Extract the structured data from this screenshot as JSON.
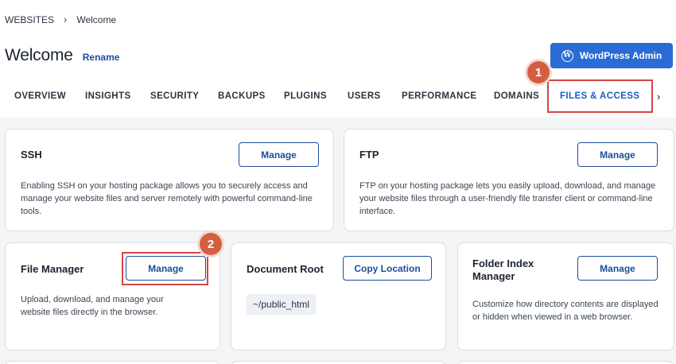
{
  "breadcrumb": {
    "root": "WEBSITES",
    "separator": ">",
    "current": "Welcome"
  },
  "header": {
    "title": "Welcome",
    "rename_label": "Rename",
    "wp_admin_label": "WordPress Admin",
    "wp_icon": "wordpress-icon"
  },
  "tabs": [
    {
      "label": "OVERVIEW"
    },
    {
      "label": "INSIGHTS"
    },
    {
      "label": "SECURITY"
    },
    {
      "label": "BACKUPS"
    },
    {
      "label": "PLUGINS"
    },
    {
      "label": "USERS"
    },
    {
      "label": "PERFORMANCE"
    },
    {
      "label": "DOMAINS"
    },
    {
      "label": "FILES & ACCESS",
      "active": true
    }
  ],
  "tabs_next_icon": "chevron-right-icon",
  "badges": {
    "one": "1",
    "two": "2"
  },
  "cards": {
    "ssh": {
      "title": "SSH",
      "button": "Manage",
      "description": "Enabling SSH on your hosting package allows you to securely access and manage your website files and server remotely with powerful command-line tools."
    },
    "ftp": {
      "title": "FTP",
      "button": "Manage",
      "description": "FTP on your hosting package lets you easily upload, download, and manage your website files through a user-friendly file transfer client or command-line interface."
    },
    "file_manager": {
      "title": "File Manager",
      "button": "Manage",
      "description": "Upload, download, and manage your website files directly in the browser."
    },
    "document_root": {
      "title": "Document Root",
      "button": "Copy Location",
      "path": "~/public_html"
    },
    "folder_index": {
      "title": "Folder Index Manager",
      "button": "Manage",
      "description": "Customize how directory contents are displayed or hidden when viewed in a web browser."
    }
  },
  "colors": {
    "accent": "#1a4f9c",
    "primary_button": "#2a6bd6",
    "highlight": "#d64545",
    "badge": "#d35f43"
  }
}
